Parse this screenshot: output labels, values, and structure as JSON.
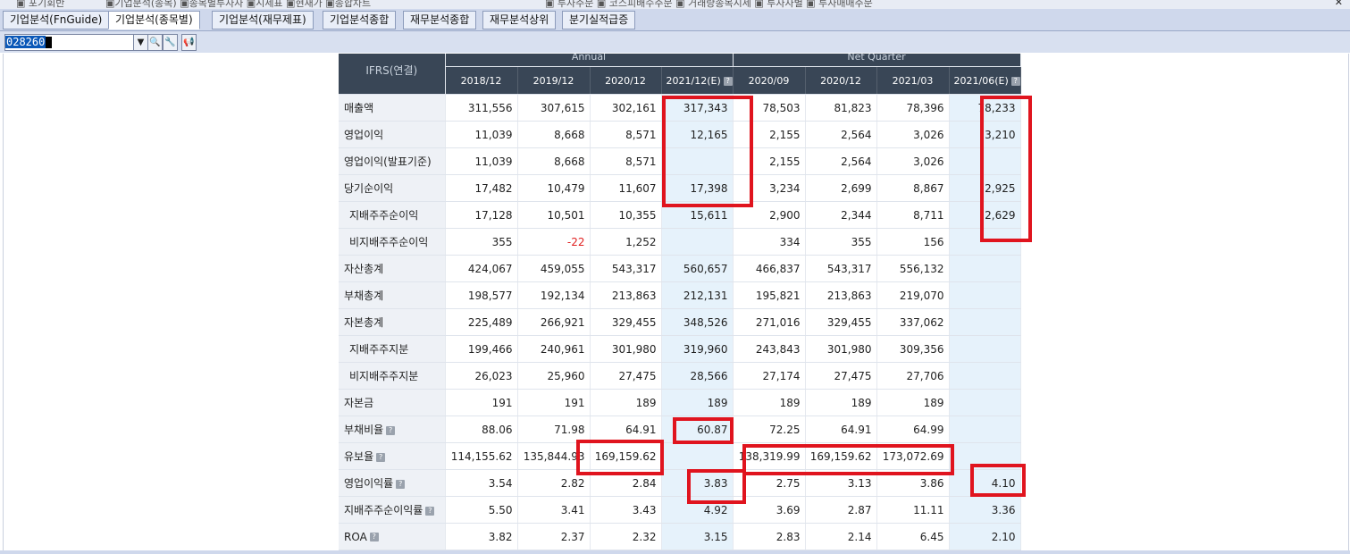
{
  "top_tabs": [
    "기업분석(FnGuide)",
    "기업분석(종목별)",
    "기업분석(재무제표)",
    "기업분석종합",
    "재무분석종합",
    "재무분석상위",
    "분기실적급증"
  ],
  "active_tab": "기업분석(종목별)",
  "stock_code": "028260",
  "table": {
    "corner": "IFRS(연결)",
    "group_headers": {
      "annual": "Annual",
      "quarter": "Net Quarter"
    },
    "periods": [
      "2018/12",
      "2019/12",
      "2020/12",
      "2021/12(E)",
      "2020/09",
      "2020/12",
      "2021/03",
      "2021/06(E)"
    ],
    "rows": [
      {
        "label": "매출액",
        "values": [
          "311,556",
          "307,615",
          "302,161",
          "317,343",
          "78,503",
          "81,823",
          "78,396",
          "78,233"
        ]
      },
      {
        "label": "영업이익",
        "values": [
          "11,039",
          "8,668",
          "8,571",
          "12,165",
          "2,155",
          "2,564",
          "3,026",
          "3,210"
        ]
      },
      {
        "label": "영업이익(발표기준)",
        "values": [
          "11,039",
          "8,668",
          "8,571",
          "",
          "2,155",
          "2,564",
          "3,026",
          ""
        ]
      },
      {
        "label": "당기순이익",
        "values": [
          "17,482",
          "10,479",
          "11,607",
          "17,398",
          "3,234",
          "2,699",
          "8,867",
          "2,925"
        ]
      },
      {
        "label": "지배주주순이익",
        "values": [
          "17,128",
          "10,501",
          "10,355",
          "15,611",
          "2,900",
          "2,344",
          "8,711",
          "2,629"
        ]
      },
      {
        "label": "비지배주주순이익",
        "values": [
          "355",
          "-22",
          "1,252",
          "",
          "334",
          "355",
          "156",
          ""
        ]
      },
      {
        "label": "자산총계",
        "values": [
          "424,067",
          "459,055",
          "543,317",
          "560,657",
          "466,837",
          "543,317",
          "556,132",
          ""
        ]
      },
      {
        "label": "부채총계",
        "values": [
          "198,577",
          "192,134",
          "213,863",
          "212,131",
          "195,821",
          "213,863",
          "219,070",
          ""
        ]
      },
      {
        "label": "자본총계",
        "values": [
          "225,489",
          "266,921",
          "329,455",
          "348,526",
          "271,016",
          "329,455",
          "337,062",
          ""
        ]
      },
      {
        "label": "지배주주지분",
        "values": [
          "199,466",
          "240,961",
          "301,980",
          "319,960",
          "243,843",
          "301,980",
          "309,356",
          ""
        ]
      },
      {
        "label": "비지배주주지분",
        "values": [
          "26,023",
          "25,960",
          "27,475",
          "28,566",
          "27,174",
          "27,475",
          "27,706",
          ""
        ]
      },
      {
        "label": "자본금",
        "values": [
          "191",
          "191",
          "189",
          "189",
          "189",
          "189",
          "189",
          ""
        ]
      },
      {
        "label": "부채비율",
        "values": [
          "88.06",
          "71.98",
          "64.91",
          "60.87",
          "72.25",
          "64.91",
          "64.99",
          ""
        ]
      },
      {
        "label": "유보율",
        "values": [
          "114,155.62",
          "135,844.93",
          "169,159.62",
          "",
          "138,319.99",
          "169,159.62",
          "173,072.69",
          ""
        ]
      },
      {
        "label": "영업이익률",
        "values": [
          "3.54",
          "2.82",
          "2.84",
          "3.83",
          "2.75",
          "3.13",
          "3.86",
          "4.10"
        ]
      },
      {
        "label": "지배주주순이익률",
        "values": [
          "5.50",
          "3.41",
          "3.43",
          "4.92",
          "3.69",
          "2.87",
          "11.11",
          "3.36"
        ]
      },
      {
        "label": "ROA",
        "values": [
          "3.82",
          "2.37",
          "2.32",
          "3.15",
          "2.83",
          "2.14",
          "6.45",
          "2.10"
        ]
      }
    ]
  },
  "colors": {
    "header_bg": "#394656",
    "estimate_bg": "#e6f2fb",
    "highlight": "#e0141e",
    "negative": "#e02020"
  }
}
